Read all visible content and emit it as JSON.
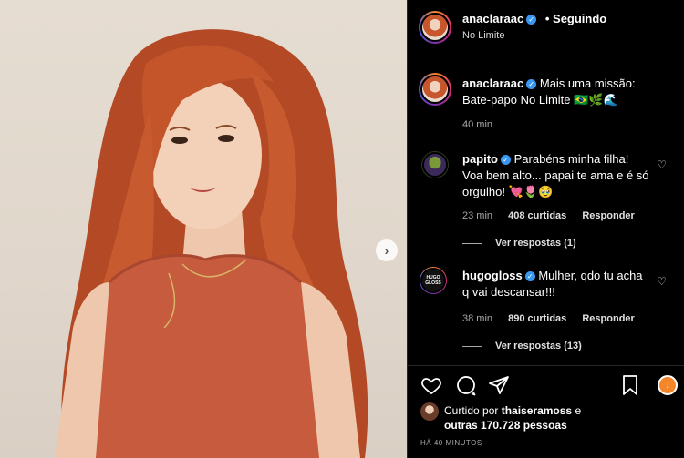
{
  "post": {
    "author": "anaclaraac",
    "follow_status": "• Seguindo",
    "location": "No Limite"
  },
  "caption": {
    "username": "anaclaraac",
    "text": "Mais uma missão: Bate-papo No Limite 🇧🇷🌿🌊",
    "time": "40 min"
  },
  "comments": [
    {
      "username": "papito",
      "text": "Parabéns minha filha! Voa bem alto... papai te ama e é só orgulho! 💘🌷🥹",
      "time": "23 min",
      "likes": "408 curtidas",
      "reply_label": "Responder",
      "view_replies": "Ver respostas (1)"
    },
    {
      "username": "hugogloss",
      "text": "Mulher, qdo tu acha q vai descansar!!!",
      "time": "38 min",
      "likes": "890 curtidas",
      "reply_label": "Responder",
      "view_replies": "Ver respostas (13)",
      "avatar_text": "HUGO GLOSS"
    }
  ],
  "likes": {
    "prefix": "Curtido por",
    "user": "thaiseramoss",
    "connector": "e",
    "others": "outras 170.728 pessoas"
  },
  "time_ago": "HÁ 40 MINUTOS",
  "colors": {
    "background": "#000000",
    "verified": "#3897f0",
    "secondary_text": "#a8a8a8",
    "hair": "#c4552b",
    "top": "#c65b3d"
  },
  "icons": [
    "verified-icon",
    "heart-icon",
    "comment-icon",
    "share-icon",
    "bookmark-icon",
    "chevron-right-icon"
  ]
}
